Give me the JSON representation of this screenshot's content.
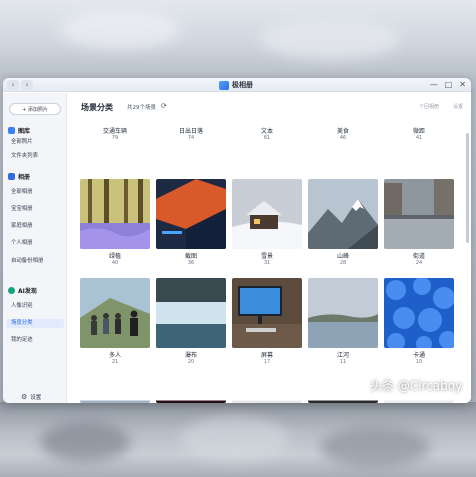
{
  "window": {
    "title": "极相册",
    "nav": {
      "back": "‹",
      "forward": "›"
    },
    "controls": {
      "minimize": "—",
      "maximize": "□",
      "close": "✕"
    }
  },
  "sidebar": {
    "add_button": "+ 添加照片",
    "sections": [
      {
        "title": "图库",
        "icon": "gallery-icon",
        "items": [
          "全部照片",
          "文件夹列表"
        ]
      },
      {
        "title": "相册",
        "icon": "album-icon",
        "items": [
          "全部相册",
          "宝宝相册",
          "家庭相册",
          "个人相册",
          "自动备份相册"
        ]
      },
      {
        "title": "AI发现",
        "icon": "ai-icon",
        "items": [
          "人像识别",
          "场景分类",
          "我的足迹"
        ]
      }
    ],
    "active_item": "场景分类",
    "settings": "设置"
  },
  "main": {
    "title": "场景分类",
    "count_text": "共29个场景",
    "actions": [
      "个回相册",
      "设置"
    ]
  },
  "scenes": [
    {
      "name": "交通车辆",
      "count": "79"
    },
    {
      "name": "日出日落",
      "count": "74"
    },
    {
      "name": "文本",
      "count": "61"
    },
    {
      "name": "美食",
      "count": "46"
    },
    {
      "name": "微距",
      "count": "41"
    },
    {
      "name": "绿植",
      "count": "40"
    },
    {
      "name": "截图",
      "count": "36"
    },
    {
      "name": "雪景",
      "count": "31"
    },
    {
      "name": "山峰",
      "count": "28"
    },
    {
      "name": "街道",
      "count": "24"
    },
    {
      "name": "多人",
      "count": "21"
    },
    {
      "name": "瀑布",
      "count": "20"
    },
    {
      "name": "屏幕",
      "count": "17"
    },
    {
      "name": "江河",
      "count": "11"
    },
    {
      "name": "卡通",
      "count": "10"
    }
  ],
  "watermark": "头条 @Circaboy",
  "colors": {
    "accent": "#2563eb",
    "active_bg": "#e1ebfb"
  }
}
